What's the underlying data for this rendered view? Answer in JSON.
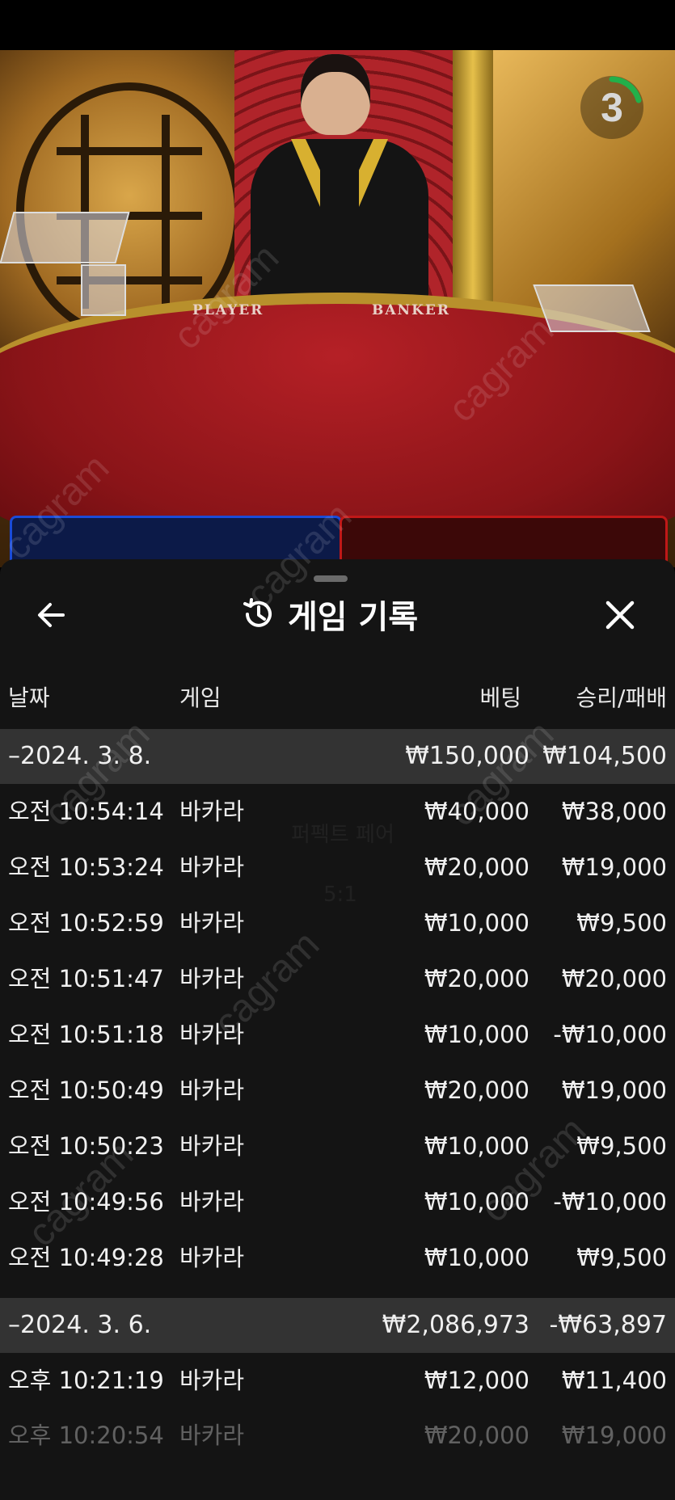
{
  "video": {
    "countdown": "3",
    "table_player_label": "PLAYER",
    "table_banker_label": "BANKER",
    "watermark": "cagram"
  },
  "colors": {
    "panel_bg": "#141414",
    "date_row_bg": "#333333",
    "player_blue": "#1a4bd8",
    "banker_red": "#c01818",
    "countdown_green": "#22b04a"
  },
  "panel": {
    "back_icon": "arrow-left-icon",
    "history_icon": "history-icon",
    "close_icon": "close-icon",
    "title": "게임 기록",
    "columns": {
      "date": "날짜",
      "game": "게임",
      "bet": "베팅",
      "result": "승리/패배"
    }
  },
  "groups": [
    {
      "date": "–2024. 3. 8.",
      "total_bet": "₩150,000",
      "total_result": "₩104,500",
      "rows": [
        {
          "time": "오전 10:54:14",
          "game": "바카라",
          "bet": "₩40,000",
          "result": "₩38,000"
        },
        {
          "time": "오전 10:53:24",
          "game": "바카라",
          "bet": "₩20,000",
          "result": "₩19,000"
        },
        {
          "time": "오전 10:52:59",
          "game": "바카라",
          "bet": "₩10,000",
          "result": "₩9,500"
        },
        {
          "time": "오전 10:51:47",
          "game": "바카라",
          "bet": "₩20,000",
          "result": "₩20,000"
        },
        {
          "time": "오전 10:51:18",
          "game": "바카라",
          "bet": "₩10,000",
          "result": "-₩10,000"
        },
        {
          "time": "오전 10:50:49",
          "game": "바카라",
          "bet": "₩20,000",
          "result": "₩19,000"
        },
        {
          "time": "오전 10:50:23",
          "game": "바카라",
          "bet": "₩10,000",
          "result": "₩9,500"
        },
        {
          "time": "오전 10:49:56",
          "game": "바카라",
          "bet": "₩10,000",
          "result": "-₩10,000"
        },
        {
          "time": "오전 10:49:28",
          "game": "바카라",
          "bet": "₩10,000",
          "result": "₩9,500"
        }
      ]
    },
    {
      "date": "–2024. 3. 6.",
      "total_bet": "₩2,086,973",
      "total_result": "-₩63,897",
      "rows": [
        {
          "time": "오후 10:21:19",
          "game": "바카라",
          "bet": "₩12,000",
          "result": "₩11,400"
        },
        {
          "time": "오후 10:20:54",
          "game": "바카라",
          "bet": "₩20,000",
          "result": "₩19,000"
        }
      ]
    }
  ]
}
